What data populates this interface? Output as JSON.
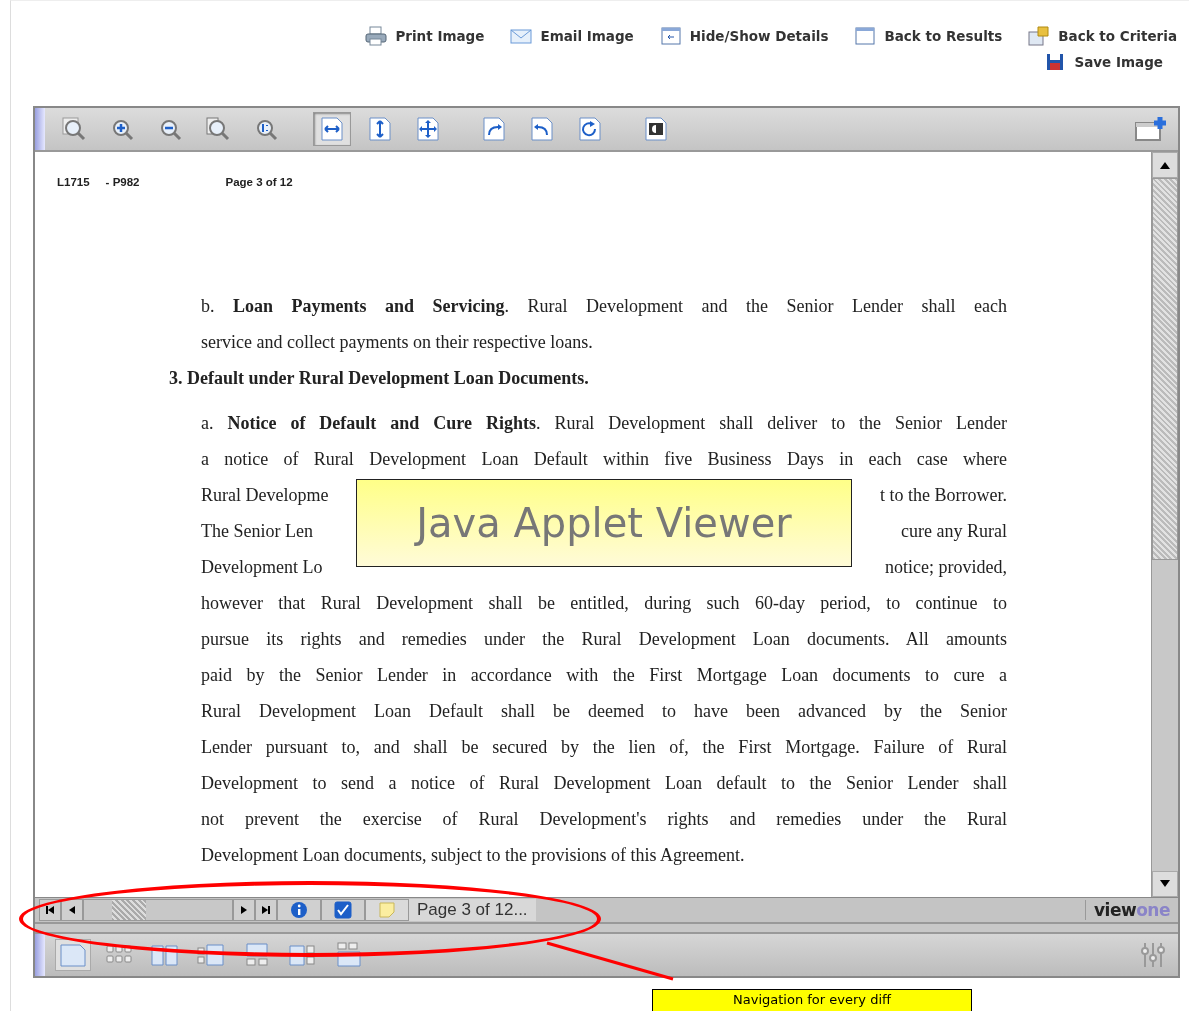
{
  "top_links": [
    {
      "label": "Print Image"
    },
    {
      "label": "Email Image"
    },
    {
      "label": "Hide/Show Details"
    },
    {
      "label": "Back to Results"
    },
    {
      "label": "Back to Criteria"
    },
    {
      "label": "Save Image"
    }
  ],
  "toolbar": {
    "tools": [
      {
        "selected": false
      },
      {
        "selected": false
      },
      {
        "selected": false
      },
      {
        "selected": false
      },
      {
        "selected": false
      },
      {
        "selected": true
      },
      {
        "selected": false
      },
      {
        "selected": false
      },
      {
        "selected": false
      },
      {
        "selected": false
      },
      {
        "selected": false
      },
      {
        "selected": false
      }
    ]
  },
  "document": {
    "header": {
      "doc_id": "L1715",
      "ref": "- P982",
      "page": "Page 3 of 12"
    },
    "blocks": [
      {
        "kind": "para",
        "lines": [
          {
            "text": "b.  **Loan Payments and Servicing**. Rural Development and the Senior Lender shall each"
          },
          {
            "text": "service and collect payments on their respective loans."
          }
        ]
      },
      {
        "kind": "heading",
        "text": "3. Default under Rural Development Loan Documents."
      },
      {
        "kind": "para",
        "lines": [
          {
            "text": "a. **Notice of Default and Cure Rights**. Rural Development shall deliver to the Senior Lender"
          },
          {
            "text": "a notice of Rural Development Loan Default within five Business Days in each case where"
          },
          {
            "left": "Rural Developme",
            "right": "t to the Borrower."
          },
          {
            "left": "The Senior Len",
            "right": "cure any Rural"
          },
          {
            "left": "Development Lo",
            "right": "notice; provided,"
          },
          {
            "text": "however that Rural Development shall be entitled, during such 60-day period, to continue to"
          },
          {
            "text": "pursue its rights and remedies under the Rural Development Loan documents.  All amounts"
          },
          {
            "text": "paid by the Senior Lender in accordance with the First Mortgage Loan documents to cure a"
          },
          {
            "text": "Rural Development Loan Default shall be deemed to have been advanced by the Senior"
          },
          {
            "text": "Lender pursuant to, and shall be secured by the lien of, the First Mortgage.  Failure of Rural"
          },
          {
            "text": "Development to send a notice of Rural Development Loan default to the Senior Lender shall"
          },
          {
            "text": "not prevent the exercise of Rural Development's rights and remedies under the Rural"
          },
          {
            "text": "Development Loan documents, subject to the provisions of this Agreement."
          }
        ]
      }
    ]
  },
  "overlay_label": "Java Applet Viewer",
  "nav_bar": {
    "checkbox_checked": true,
    "page_label": "Page 3 of 12...",
    "logo": {
      "part_1": "view",
      "part_2": "one"
    }
  },
  "bottom_toolbar": {
    "layouts": [
      {
        "selected": true
      },
      {
        "selected": false
      },
      {
        "selected": false
      },
      {
        "selected": false
      },
      {
        "selected": false
      },
      {
        "selected": false
      },
      {
        "selected": false
      }
    ]
  },
  "callout": "Navigation for every diff"
}
